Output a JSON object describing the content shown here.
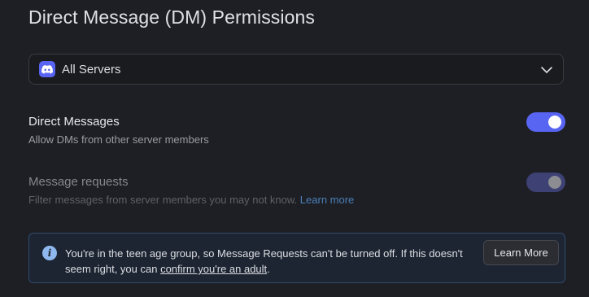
{
  "header": {
    "title": "Direct Message (DM) Permissions"
  },
  "server_select": {
    "icon": "discord-logo-icon",
    "selected": "All Servers",
    "chevron": "chevron-down-icon"
  },
  "settings": [
    {
      "title": "Direct Messages",
      "description": "Allow DMs from other server members",
      "enabled": true,
      "disabled": false,
      "accent": "#5865f2"
    },
    {
      "title": "Message requests",
      "description": "Filter messages from server members you may not know.",
      "link": "Learn more",
      "enabled": true,
      "disabled": true,
      "accent": "#3d4173"
    }
  ],
  "notice": {
    "icon": "info-icon",
    "text_before": "You're in the teen age group, so Message Requests can't be turned off. If this doesn't seem right, you can ",
    "link": "confirm you're an adult",
    "text_after": ".",
    "button": "Learn More"
  }
}
